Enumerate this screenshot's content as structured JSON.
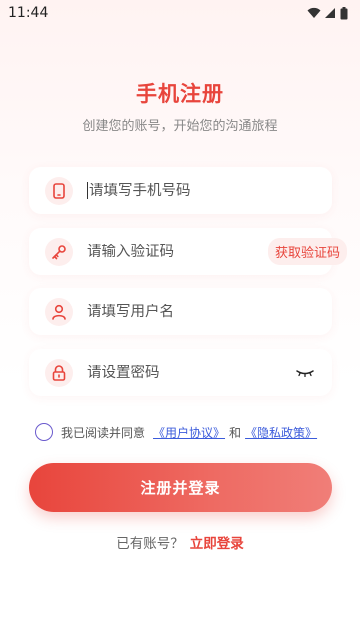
{
  "status_bar": {
    "time": "11:44"
  },
  "header": {
    "title": "手机注册",
    "subtitle": "创建您的账号，开始您的沟通旅程"
  },
  "form": {
    "phone": {
      "placeholder": "请填写手机号码",
      "icon": "phone-icon"
    },
    "code": {
      "placeholder": "请输入验证码",
      "icon": "key-icon",
      "button_label": "获取验证码"
    },
    "username": {
      "placeholder": "请填写用户名",
      "icon": "user-icon"
    },
    "password": {
      "placeholder": "请设置密码",
      "icon": "lock-icon",
      "toggle_icon": "eye-closed-icon"
    }
  },
  "agreement": {
    "prefix": "我已阅读并同意",
    "user_agreement": "《用户协议》",
    "conjunction": "和",
    "privacy_policy": "《隐私政策》",
    "checked": false
  },
  "submit_label": "注册并登录",
  "login_prompt": {
    "text": "已有账号？",
    "link": "立即登录"
  },
  "colors": {
    "accent": "#e8453c",
    "icon_bg": "#fdeeed",
    "link": "#3b5bdb"
  }
}
